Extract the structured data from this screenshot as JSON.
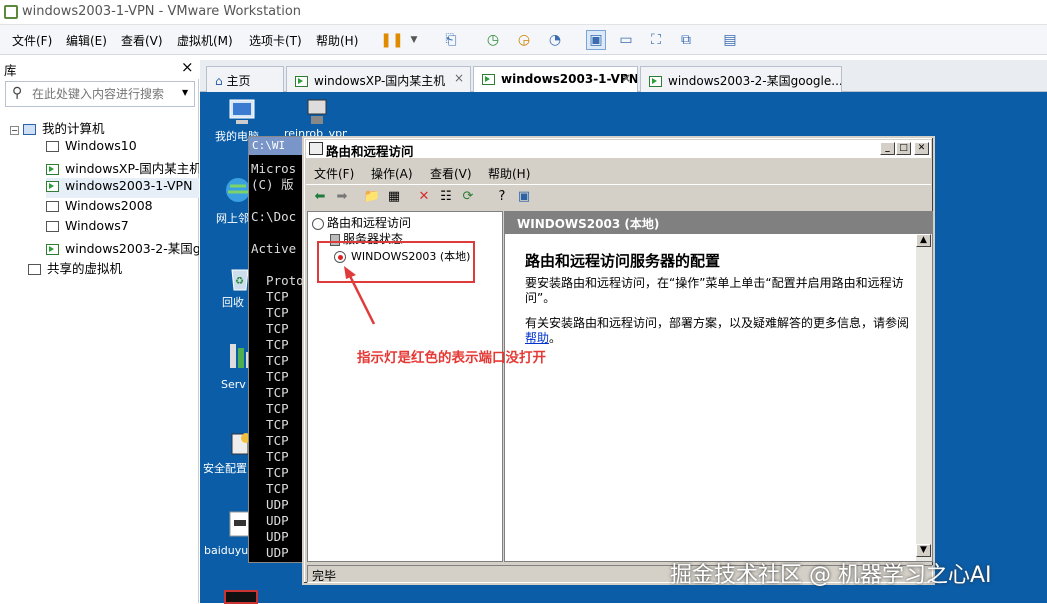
{
  "window": {
    "title": "windows2003-1-VPN - VMware Workstation"
  },
  "menubar": {
    "items": [
      "文件(F)",
      "编辑(E)",
      "查看(V)",
      "虚拟机(M)",
      "选项卡(T)",
      "帮助(H)"
    ]
  },
  "library": {
    "title": "库",
    "close": "×",
    "search_placeholder": "在此处键入内容进行搜索",
    "tree": {
      "root": "我的计算机",
      "vms": [
        "Windows10",
        "windowsXP-国内某主机",
        "windows2003-1-VPN",
        "Windows2008",
        "Windows7",
        "windows2003-2-某国g"
      ],
      "shared": "共享的虚拟机"
    }
  },
  "tabs": [
    {
      "label": "主页"
    },
    {
      "label": "windowsXP-国内某主机"
    },
    {
      "label": "windows2003-1-VPN"
    },
    {
      "label": "windows2003-2-某国google..."
    }
  ],
  "tab_close": "×",
  "desktop": {
    "icons": [
      "我的电脑",
      "网上邻",
      "回收",
      "Serv",
      "安全配置",
      "baiduyu"
    ],
    "partial_icon_label": "reinrob_vpn"
  },
  "cmd": {
    "title": "C:\\WI",
    "lines": [
      "Micros",
      "(C) 版",
      "",
      "C:\\Doc",
      "",
      "Active",
      "",
      "  Proto",
      "  TCP",
      "  TCP",
      "  TCP",
      "  TCP",
      "  TCP",
      "  TCP",
      "  TCP",
      "  TCP",
      "  TCP",
      "  TCP",
      "  TCP",
      "  TCP",
      "  TCP",
      "  UDP",
      "  UDP",
      "  UDP",
      "  UDP"
    ]
  },
  "rras": {
    "title": "路由和远程访问",
    "menu": [
      "文件(F)",
      "操作(A)",
      "查看(V)",
      "帮助(H)"
    ],
    "tree": {
      "root": "路由和远程访问",
      "status": "服务器状态",
      "server": "WINDOWS2003 (本地)"
    },
    "detail": {
      "header": "WINDOWS2003 (本地)",
      "heading": "路由和远程访问服务器的配置",
      "para1": "要安装路由和远程访问，在“操作”菜单上单击“配置并启用路由和远程访问”。",
      "para2_prefix": "有关安装路由和远程访问，部署方案，以及疑难解答的更多信息，请参阅",
      "help_link": "帮助",
      "para2_suffix": "。"
    },
    "status": "完毕"
  },
  "annotation": {
    "text": "指示灯是红色的表示端口没打开",
    "color": "#e53935"
  },
  "watermark": "掘金技术社区 @ 机器学习之心AI",
  "colors": {
    "desktop": "#0b5da8",
    "annotation": "#e03b3b"
  }
}
